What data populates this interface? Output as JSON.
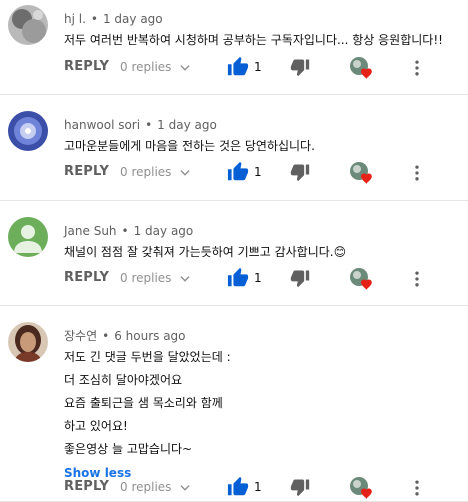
{
  "comments": [
    {
      "author": "hj l.",
      "time": "1 day ago",
      "lines": [
        "저두  여러번 반복하여 시청하며 공부하는 구독자입니다... 항상 응원합니다!!"
      ],
      "reply_label": "REPLY",
      "replies_label": "0 replies",
      "likes": "1",
      "avatar_color": "#8a8a8a"
    },
    {
      "author": "hanwool sori",
      "time": "1 day ago",
      "lines": [
        "고마운분들에게 마음을 전하는 것은 당연하십니다."
      ],
      "reply_label": "REPLY",
      "replies_label": "0 replies",
      "likes": "1",
      "avatar_color": "#4a5fc1"
    },
    {
      "author": "Jane Suh",
      "time": "1 day ago",
      "lines": [
        "채널이 점점 잘 갖춰져 가는듯하여 기쁘고 감사합니다.😊"
      ],
      "reply_label": "REPLY",
      "replies_label": "0 replies",
      "likes": "1",
      "avatar_color": "#5fa34a"
    },
    {
      "author": "장수연",
      "time": "6 hours ago",
      "lines": [
        "저도 긴 댓글 두번을 달았었는데 :",
        "더 조심히 달아야겠어요",
        "요즘 출퇴근을 샘 목소리와 함께",
        "하고 있어요!",
        "좋은영상 늘 고맙습니다~"
      ],
      "show_less": "Show less",
      "reply_label": "REPLY",
      "replies_label": "0 replies",
      "likes": "1",
      "avatar_color": "#7a4a35"
    }
  ],
  "colors": {
    "link_blue": "#1a73e8",
    "like_blue": "#065fd4",
    "heart_red": "#e62117",
    "meta_gray": "#606060"
  }
}
